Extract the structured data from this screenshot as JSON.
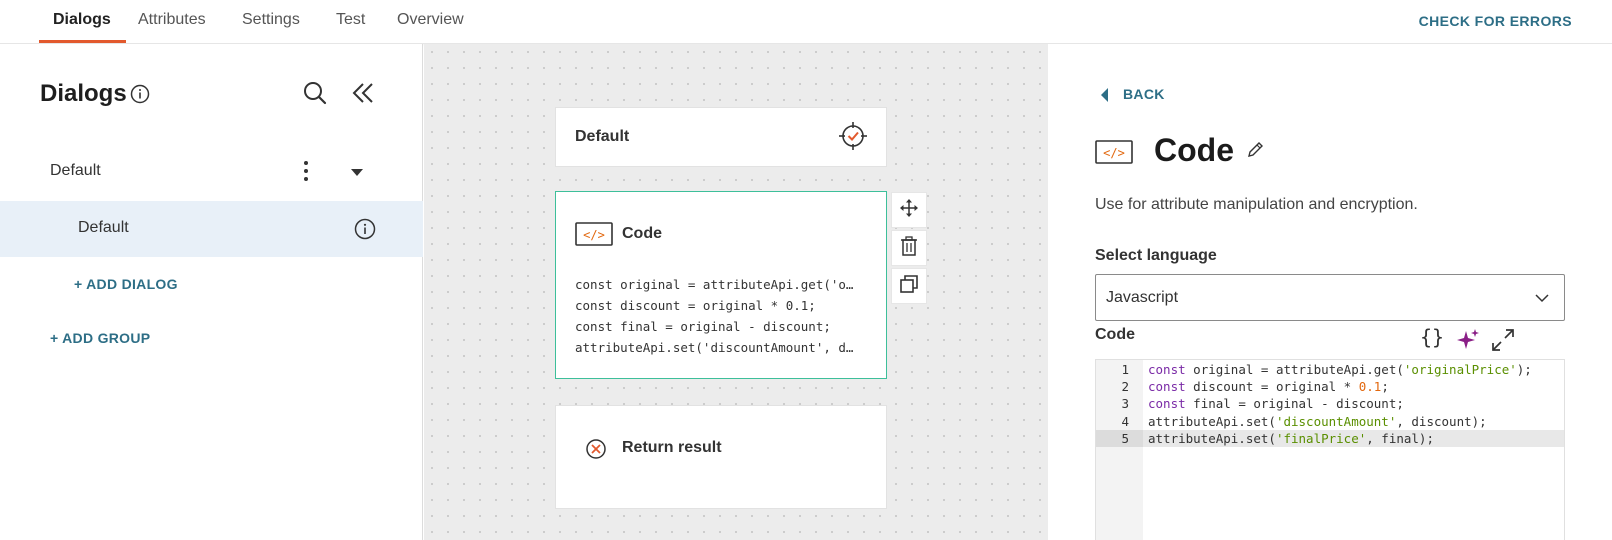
{
  "topbar": {
    "tabs": [
      "Dialogs",
      "Attributes",
      "Settings",
      "Test",
      "Overview"
    ],
    "active_tab": "Dialogs",
    "check_errors_label": "CHECK FOR ERRORS"
  },
  "sidebar": {
    "title": "Dialogs",
    "group_label": "Default",
    "dialog_label": "Default",
    "add_dialog_label": "+ ADD DIALOG",
    "add_group_label": "+ ADD GROUP"
  },
  "canvas": {
    "default_node_label": "Default",
    "code_node": {
      "label": "Code",
      "badge": "</>",
      "snippet": [
        "const original = attributeApi.get('o…",
        "const discount = original * 0.1;",
        "const final = original - discount;",
        "attributeApi.set('discountAmount', d…"
      ]
    },
    "return_node_label": "Return result"
  },
  "panel": {
    "back_label": "BACK",
    "badge": "</>",
    "title": "Code",
    "description": "Use for attribute manipulation and encryption.",
    "select_language_label": "Select language",
    "language_value": "Javascript",
    "code_label": "Code",
    "format_icon_text": "{}",
    "active_line": 5,
    "code_lines": [
      {
        "num": "1",
        "parts": [
          {
            "t": "const",
            "c": "kw"
          },
          {
            "t": " original = attributeApi.get(",
            "c": ""
          },
          {
            "t": "'originalPrice'",
            "c": "str"
          },
          {
            "t": ");",
            "c": ""
          }
        ]
      },
      {
        "num": "2",
        "parts": [
          {
            "t": "const",
            "c": "kw"
          },
          {
            "t": " discount = original * ",
            "c": ""
          },
          {
            "t": "0.1",
            "c": "nm"
          },
          {
            "t": ";",
            "c": ""
          }
        ]
      },
      {
        "num": "3",
        "parts": [
          {
            "t": "const",
            "c": "kw"
          },
          {
            "t": " final = original - discount;",
            "c": ""
          }
        ]
      },
      {
        "num": "4",
        "parts": [
          {
            "t": "attributeApi.set(",
            "c": ""
          },
          {
            "t": "'discountAmount'",
            "c": "str"
          },
          {
            "t": ", discount);",
            "c": ""
          }
        ]
      },
      {
        "num": "5",
        "parts": [
          {
            "t": "attributeApi.set(",
            "c": ""
          },
          {
            "t": "'finalPrice'",
            "c": "str"
          },
          {
            "t": ", final);",
            "c": ""
          }
        ]
      }
    ]
  },
  "colors": {
    "accent_underline": "#e2592d",
    "link_blue": "#2d6e86",
    "selected_node_border": "#3dbf9a",
    "code_badge_orange": "#e2680f",
    "ai_icon_purple": "#8a1f86"
  }
}
